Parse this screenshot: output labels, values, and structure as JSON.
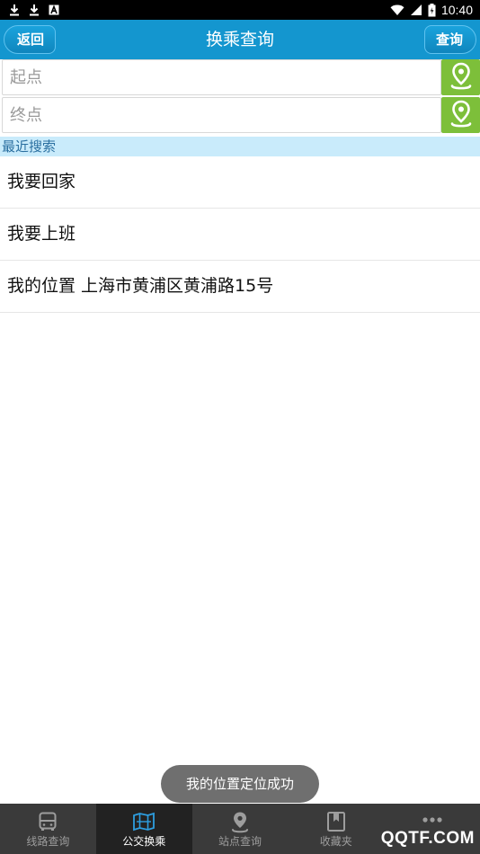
{
  "status_bar": {
    "time": "10:40"
  },
  "header": {
    "title": "换乘查询",
    "back_label": "返回",
    "query_label": "查询"
  },
  "start_input": {
    "placeholder": "起点",
    "value": ""
  },
  "end_input": {
    "placeholder": "终点",
    "value": ""
  },
  "recent": {
    "header": "最近搜索",
    "items": [
      {
        "label": "我要回家"
      },
      {
        "label": "我要上班"
      },
      {
        "label": "我的位置 上海市黄浦区黄浦路15号"
      }
    ]
  },
  "toast": "我的位置定位成功",
  "bottom_nav": {
    "tabs": [
      {
        "label": "线路查询",
        "icon": "bus-icon",
        "active": false
      },
      {
        "label": "公交换乘",
        "icon": "map-icon",
        "active": true
      },
      {
        "label": "站点查询",
        "icon": "location-pin-icon",
        "active": false
      },
      {
        "label": "收藏夹",
        "icon": "bookmark-icon",
        "active": false
      },
      {
        "label": "",
        "icon": "more-icon",
        "active": false
      }
    ]
  },
  "watermark": "QQTF.COM",
  "colors": {
    "title_bar": "#1496cf",
    "location_button": "#7dbf3a",
    "recent_header_bg": "#c9ebfb",
    "bottom_nav": "#3a3a3a",
    "active_tab": "#222222"
  }
}
